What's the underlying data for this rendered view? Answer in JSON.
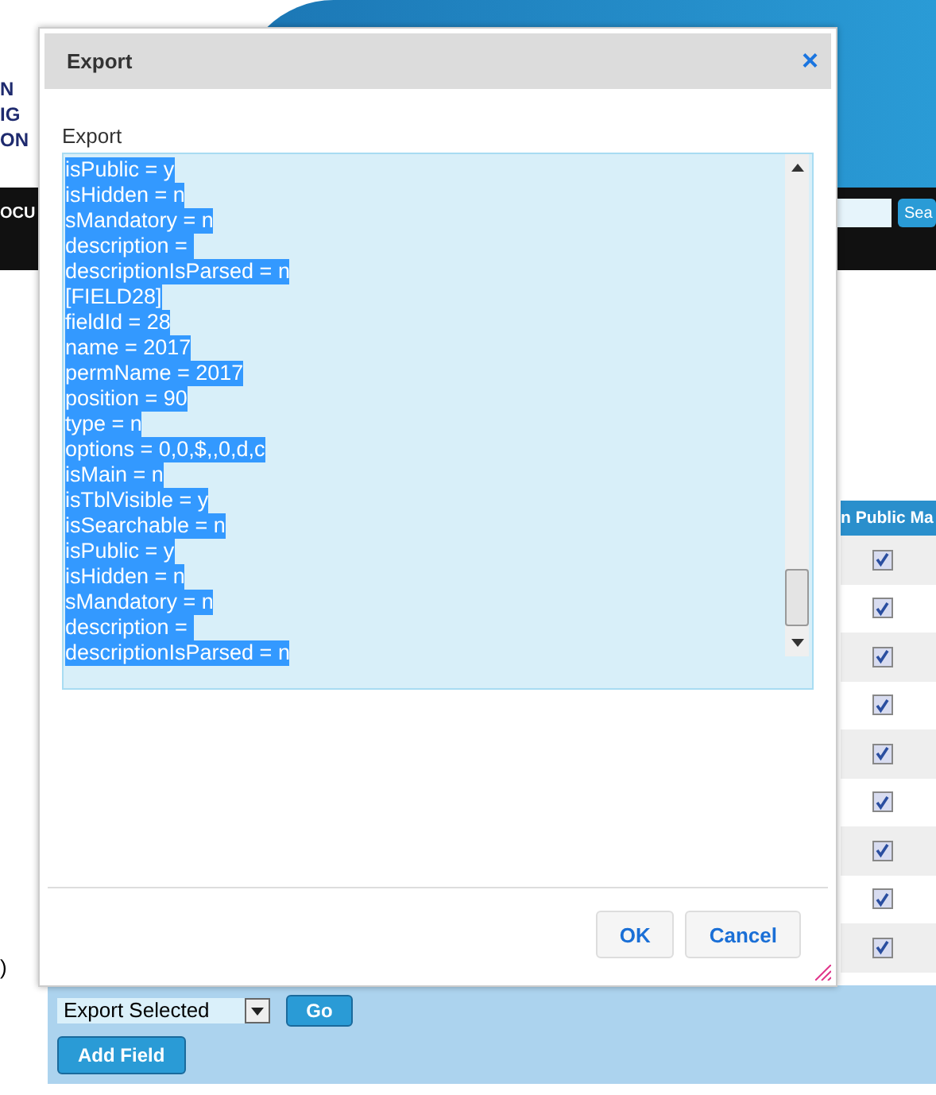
{
  "page": {
    "logo_lines": [
      "N",
      "IG",
      "ON"
    ],
    "nav_text": "OCU",
    "search_button": "Sea",
    "table": {
      "header": "n Public Ma",
      "rows": [
        {
          "checked": true
        },
        {
          "checked": true
        },
        {
          "checked": true
        },
        {
          "checked": true
        },
        {
          "checked": true
        },
        {
          "checked": true
        },
        {
          "checked": true
        },
        {
          "checked": true
        },
        {
          "checked": true
        }
      ]
    },
    "side_mark": ")",
    "bulk_action": {
      "value": "Export Selected",
      "go": "Go"
    },
    "add_field": "Add Field"
  },
  "dialog": {
    "title": "Export",
    "close": "×",
    "field_label": "Export",
    "text_selected": true,
    "lines": [
      "isPublic = y",
      "isHidden = n",
      "sMandatory = n",
      "description = ",
      "descriptionIsParsed = n",
      "[FIELD28]",
      "fieldId = 28",
      "name = 2017",
      "permName = 2017",
      "position = 90",
      "type = n",
      "options = 0,0,$,,0,d,c",
      "isMain = n",
      "isTblVisible = y",
      "isSearchable = n",
      "isPublic = y",
      "isHidden = n",
      "sMandatory = n",
      "description = ",
      "descriptionIsParsed = n"
    ],
    "buttons": [
      "OK",
      "Cancel"
    ]
  }
}
